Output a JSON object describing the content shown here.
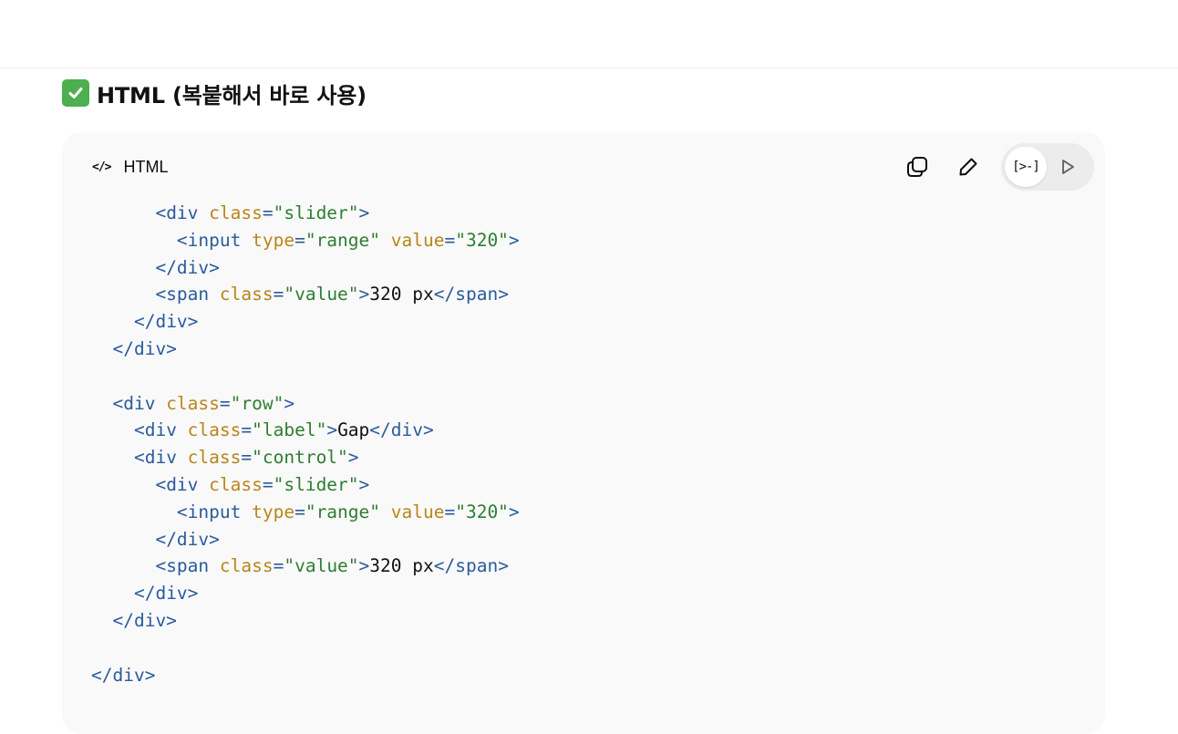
{
  "heading": {
    "icon": "check-mark-button-icon",
    "title": "HTML (복붙해서 바로 사용)"
  },
  "code_block": {
    "language_label": "HTML",
    "toolbar": {
      "copy_icon": "copy-icon",
      "edit_icon": "pencil-icon",
      "code_view_icon": "code-view-icon",
      "preview_icon": "play-icon"
    },
    "colors": {
      "tag": "#2a5b9c",
      "attribute": "#b8861b",
      "string": "#2f7d32",
      "text": "#111111",
      "background": "#f9f9f9"
    },
    "lines": [
      {
        "indent": "      ",
        "tokens": [
          {
            "t": "tag",
            "v": "<div "
          },
          {
            "t": "attr",
            "v": "class"
          },
          {
            "t": "tag",
            "v": "="
          },
          {
            "t": "str",
            "v": "\"slider\""
          },
          {
            "t": "tag",
            "v": ">"
          }
        ]
      },
      {
        "indent": "        ",
        "tokens": [
          {
            "t": "tag",
            "v": "<input "
          },
          {
            "t": "attr",
            "v": "type"
          },
          {
            "t": "tag",
            "v": "="
          },
          {
            "t": "str",
            "v": "\"range\""
          },
          {
            "t": "tag",
            "v": " "
          },
          {
            "t": "attr",
            "v": "value"
          },
          {
            "t": "tag",
            "v": "="
          },
          {
            "t": "str",
            "v": "\"320\""
          },
          {
            "t": "tag",
            "v": ">"
          }
        ]
      },
      {
        "indent": "      ",
        "tokens": [
          {
            "t": "tag",
            "v": "</div>"
          }
        ]
      },
      {
        "indent": "      ",
        "tokens": [
          {
            "t": "tag",
            "v": "<span "
          },
          {
            "t": "attr",
            "v": "class"
          },
          {
            "t": "tag",
            "v": "="
          },
          {
            "t": "str",
            "v": "\"value\""
          },
          {
            "t": "tag",
            "v": ">"
          },
          {
            "t": "text",
            "v": "320 px"
          },
          {
            "t": "tag",
            "v": "</span>"
          }
        ]
      },
      {
        "indent": "    ",
        "tokens": [
          {
            "t": "tag",
            "v": "</div>"
          }
        ]
      },
      {
        "indent": "  ",
        "tokens": [
          {
            "t": "tag",
            "v": "</div>"
          }
        ]
      },
      {
        "indent": "",
        "tokens": []
      },
      {
        "indent": "  ",
        "tokens": [
          {
            "t": "tag",
            "v": "<div "
          },
          {
            "t": "attr",
            "v": "class"
          },
          {
            "t": "tag",
            "v": "="
          },
          {
            "t": "str",
            "v": "\"row\""
          },
          {
            "t": "tag",
            "v": ">"
          }
        ]
      },
      {
        "indent": "    ",
        "tokens": [
          {
            "t": "tag",
            "v": "<div "
          },
          {
            "t": "attr",
            "v": "class"
          },
          {
            "t": "tag",
            "v": "="
          },
          {
            "t": "str",
            "v": "\"label\""
          },
          {
            "t": "tag",
            "v": ">"
          },
          {
            "t": "text",
            "v": "Gap"
          },
          {
            "t": "tag",
            "v": "</div>"
          }
        ]
      },
      {
        "indent": "    ",
        "tokens": [
          {
            "t": "tag",
            "v": "<div "
          },
          {
            "t": "attr",
            "v": "class"
          },
          {
            "t": "tag",
            "v": "="
          },
          {
            "t": "str",
            "v": "\"control\""
          },
          {
            "t": "tag",
            "v": ">"
          }
        ]
      },
      {
        "indent": "      ",
        "tokens": [
          {
            "t": "tag",
            "v": "<div "
          },
          {
            "t": "attr",
            "v": "class"
          },
          {
            "t": "tag",
            "v": "="
          },
          {
            "t": "str",
            "v": "\"slider\""
          },
          {
            "t": "tag",
            "v": ">"
          }
        ]
      },
      {
        "indent": "        ",
        "tokens": [
          {
            "t": "tag",
            "v": "<input "
          },
          {
            "t": "attr",
            "v": "type"
          },
          {
            "t": "tag",
            "v": "="
          },
          {
            "t": "str",
            "v": "\"range\""
          },
          {
            "t": "tag",
            "v": " "
          },
          {
            "t": "attr",
            "v": "value"
          },
          {
            "t": "tag",
            "v": "="
          },
          {
            "t": "str",
            "v": "\"320\""
          },
          {
            "t": "tag",
            "v": ">"
          }
        ]
      },
      {
        "indent": "      ",
        "tokens": [
          {
            "t": "tag",
            "v": "</div>"
          }
        ]
      },
      {
        "indent": "      ",
        "tokens": [
          {
            "t": "tag",
            "v": "<span "
          },
          {
            "t": "attr",
            "v": "class"
          },
          {
            "t": "tag",
            "v": "="
          },
          {
            "t": "str",
            "v": "\"value\""
          },
          {
            "t": "tag",
            "v": ">"
          },
          {
            "t": "text",
            "v": "320 px"
          },
          {
            "t": "tag",
            "v": "</span>"
          }
        ]
      },
      {
        "indent": "    ",
        "tokens": [
          {
            "t": "tag",
            "v": "</div>"
          }
        ]
      },
      {
        "indent": "  ",
        "tokens": [
          {
            "t": "tag",
            "v": "</div>"
          }
        ]
      },
      {
        "indent": "",
        "tokens": []
      },
      {
        "indent": "",
        "tokens": [
          {
            "t": "tag",
            "v": "</div>"
          }
        ]
      }
    ]
  }
}
